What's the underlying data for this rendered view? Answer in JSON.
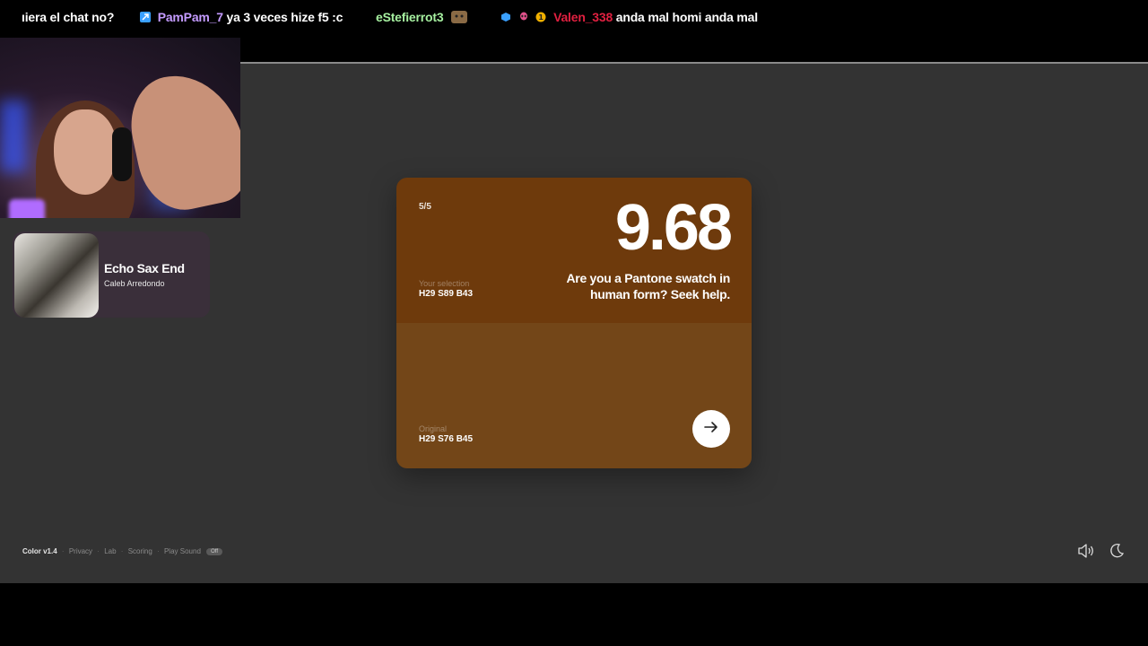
{
  "chat": {
    "messages": [
      {
        "user": "",
        "user_color": "#ffffff",
        "text": "ıiera el chat no?"
      },
      {
        "user": "PamPam_7",
        "user_color": "#c49bff",
        "text": "ya 3 veces hize f5 :c"
      },
      {
        "user": "eStefierrot3",
        "user_color": "#a6f0a0",
        "text": ""
      },
      {
        "user": "Valen_338",
        "user_color": "#e02040",
        "text": "anda mal homi anda mal"
      }
    ],
    "badge_colors": [
      "#3aa0ff",
      "#e0508a",
      "#f0b000"
    ]
  },
  "now_playing": {
    "title": "Echo Sax End",
    "artist": "Caleb Arredondo"
  },
  "card": {
    "round": "5/5",
    "score": "9.68",
    "message": "Are you a Pantone swatch in human form? Seek help.",
    "selection_label": "Your selection",
    "selection_value": "H29 S89 B43",
    "original_label": "Original",
    "original_value": "H29 S76 B45",
    "selection_color": "#6e3a0c",
    "original_color": "#734618",
    "next_icon": "arrow-right-icon"
  },
  "footer": {
    "brand": "Color v1.4",
    "links": [
      "Privacy",
      "Lab",
      "Scoring",
      "Play Sound"
    ],
    "pill": "Off",
    "sound_icon": "speaker-icon",
    "theme_icon": "moon-icon"
  },
  "colors": {
    "stage_bg": "#333333",
    "chat_bg": "#000000"
  }
}
